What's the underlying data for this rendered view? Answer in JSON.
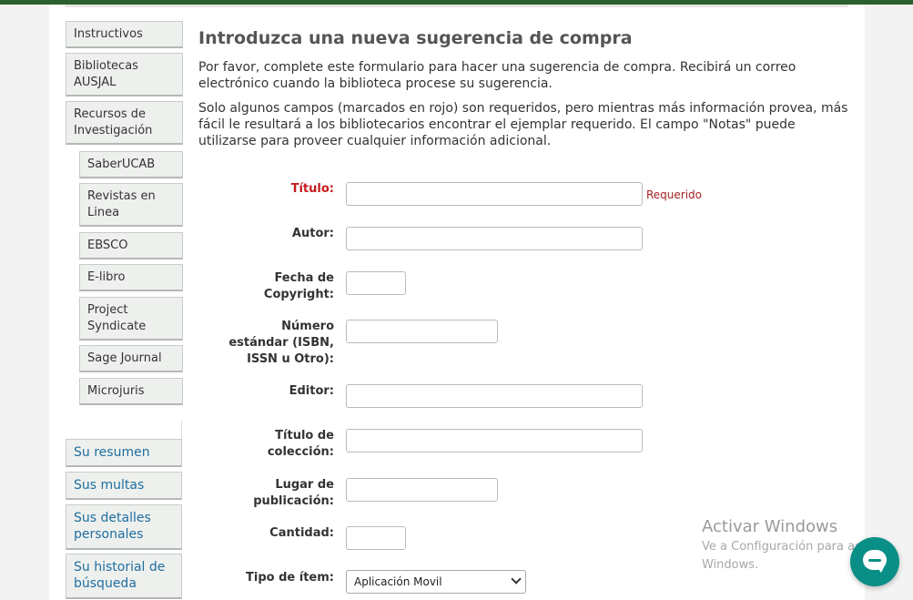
{
  "nav": {
    "main_items": [
      {
        "label": "Instructivos"
      },
      {
        "label": "Bibliotecas AUSJAL"
      },
      {
        "label": "Recursos de Investigación"
      }
    ],
    "sub_items": [
      {
        "label": "SaberUCAB"
      },
      {
        "label": "Revistas en Linea"
      },
      {
        "label": "EBSCO"
      },
      {
        "label": "E-libro"
      },
      {
        "label": "Project Syndicate"
      },
      {
        "label": "Sage Journal"
      },
      {
        "label": "Microjuris"
      }
    ],
    "user_items": [
      {
        "label": "Su resumen"
      },
      {
        "label": "Sus multas"
      },
      {
        "label": "Sus detalles personales"
      },
      {
        "label": "Su historial de búsqueda"
      }
    ]
  },
  "form": {
    "heading": "Introduzca una nueva sugerencia de compra",
    "intro1": "Por favor, complete este formulario para hacer una sugerencia de compra. Recibirá un correo electrónico cuando la biblioteca procese su sugerencia.",
    "intro2": "Solo algunos campos (marcados en rojo) son requeridos, pero mientras más información provea, más fácil le resultará a los bibliotecarios encontrar el ejemplar requerido. El campo \"Notas\" puede utilizarse para proveer cualquier información adicional.",
    "required_note": "Requerido",
    "fields": {
      "title": {
        "label": "Título:",
        "value": ""
      },
      "author": {
        "label": "Autor:",
        "value": ""
      },
      "copyright": {
        "label": "Fecha de Copyright:",
        "value": ""
      },
      "standard_number": {
        "label": "Número estándar (ISBN, ISSN u Otro):",
        "value": ""
      },
      "publisher": {
        "label": "Editor:",
        "value": ""
      },
      "collection_title": {
        "label": "Título de colección:",
        "value": ""
      },
      "publication_place": {
        "label": "Lugar de publicación:",
        "value": ""
      },
      "quantity": {
        "label": "Cantidad:",
        "value": ""
      },
      "item_type": {
        "label": "Tipo de ítem:",
        "selected": "Aplicación Movil"
      }
    }
  },
  "watermark": {
    "line1": "Activar Windows",
    "line2": "Ve a Configuración para activar",
    "line3": "Windows."
  },
  "icons": {
    "chat": "chat-bubble-icon"
  }
}
